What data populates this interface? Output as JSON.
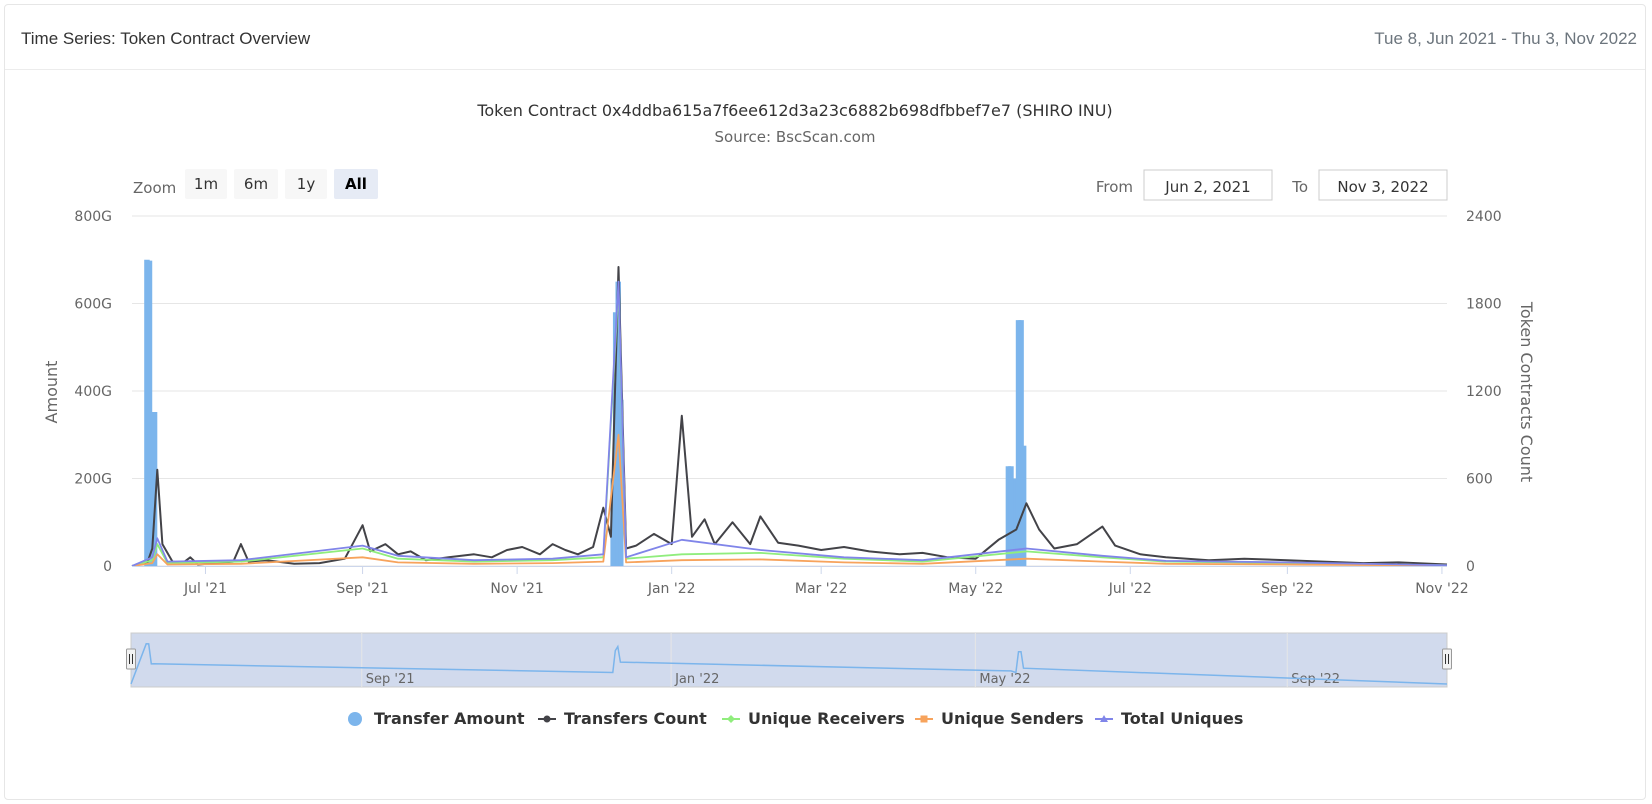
{
  "header": {
    "title": "Time Series: Token Contract Overview",
    "date_range": "Tue 8, Jun 2021 - Thu 3, Nov 2022"
  },
  "zoom": {
    "label": "Zoom",
    "buttons": [
      "1m",
      "6m",
      "1y",
      "All"
    ],
    "active": "All"
  },
  "range_selector": {
    "from_label": "From",
    "from_value": "Jun 2, 2021",
    "to_label": "To",
    "to_value": "Nov 3, 2022"
  },
  "chart_data": {
    "type": "line",
    "title": "Token Contract 0x4ddba615a7f6ee612d3a23c6882b698dfbbef7e7 (SHIRO INU)",
    "subtitle": "Source: BscScan.com",
    "x_range": [
      "2021-06-02",
      "2022-11-03"
    ],
    "x_tick_labels": [
      "Jul '21",
      "Sep '21",
      "Nov '21",
      "Jan '22",
      "Mar '22",
      "May '22",
      "Jul '22",
      "Sep '22",
      "Nov '22"
    ],
    "x_tick_dates": [
      "2021-07-01",
      "2021-09-01",
      "2021-11-01",
      "2022-01-01",
      "2022-03-01",
      "2022-05-01",
      "2022-07-01",
      "2022-09-01",
      "2022-11-01"
    ],
    "y_left": {
      "label": "Amount",
      "range": [
        0,
        800
      ],
      "unit": "G",
      "ticks": [
        "0",
        "200G",
        "400G",
        "600G",
        "800G"
      ]
    },
    "y_right": {
      "label": "Token Contracts Count",
      "range": [
        0,
        2400
      ],
      "ticks": [
        "0",
        "600",
        "1200",
        "1800",
        "2400"
      ]
    },
    "grid": true,
    "legend_position": "bottom",
    "series": [
      {
        "name": "Transfer Amount",
        "type": "column",
        "axis": "left",
        "color": "#7cb5ec",
        "points": [
          [
            "2021-06-08",
            700
          ],
          [
            "2021-06-09",
            698
          ],
          [
            "2021-06-10",
            350
          ],
          [
            "2021-06-11",
            352
          ],
          [
            "2021-12-09",
            200
          ],
          [
            "2021-12-10",
            580
          ],
          [
            "2021-12-11",
            650
          ],
          [
            "2021-12-12",
            380
          ],
          [
            "2022-05-14",
            228
          ],
          [
            "2022-05-15",
            228
          ],
          [
            "2022-05-17",
            200
          ],
          [
            "2022-05-18",
            562
          ],
          [
            "2022-05-19",
            562
          ],
          [
            "2022-05-20",
            275
          ]
        ]
      },
      {
        "name": "Transfers Count",
        "type": "line",
        "axis": "right",
        "color": "#434348",
        "points": [
          [
            "2021-06-02",
            0
          ],
          [
            "2021-06-08",
            20
          ],
          [
            "2021-06-10",
            120
          ],
          [
            "2021-06-12",
            660
          ],
          [
            "2021-06-14",
            150
          ],
          [
            "2021-06-18",
            30
          ],
          [
            "2021-06-22",
            20
          ],
          [
            "2021-06-25",
            60
          ],
          [
            "2021-06-28",
            10
          ],
          [
            "2021-07-05",
            20
          ],
          [
            "2021-07-12",
            30
          ],
          [
            "2021-07-15",
            150
          ],
          [
            "2021-07-18",
            30
          ],
          [
            "2021-07-25",
            40
          ],
          [
            "2021-08-05",
            15
          ],
          [
            "2021-08-15",
            20
          ],
          [
            "2021-08-25",
            50
          ],
          [
            "2021-09-01",
            280
          ],
          [
            "2021-09-04",
            100
          ],
          [
            "2021-09-10",
            150
          ],
          [
            "2021-09-15",
            80
          ],
          [
            "2021-09-20",
            100
          ],
          [
            "2021-09-26",
            40
          ],
          [
            "2021-10-05",
            60
          ],
          [
            "2021-10-15",
            80
          ],
          [
            "2021-10-22",
            60
          ],
          [
            "2021-10-28",
            110
          ],
          [
            "2021-11-03",
            130
          ],
          [
            "2021-11-10",
            80
          ],
          [
            "2021-11-15",
            150
          ],
          [
            "2021-11-20",
            110
          ],
          [
            "2021-11-25",
            80
          ],
          [
            "2021-12-01",
            130
          ],
          [
            "2021-12-05",
            400
          ],
          [
            "2021-12-08",
            200
          ],
          [
            "2021-12-11",
            2050
          ],
          [
            "2021-12-14",
            120
          ],
          [
            "2021-12-18",
            140
          ],
          [
            "2021-12-25",
            220
          ],
          [
            "2022-01-01",
            150
          ],
          [
            "2022-01-05",
            1030
          ],
          [
            "2022-01-09",
            200
          ],
          [
            "2022-01-14",
            320
          ],
          [
            "2022-01-18",
            150
          ],
          [
            "2022-01-25",
            300
          ],
          [
            "2022-02-01",
            150
          ],
          [
            "2022-02-05",
            340
          ],
          [
            "2022-02-12",
            160
          ],
          [
            "2022-02-20",
            140
          ],
          [
            "2022-03-01",
            110
          ],
          [
            "2022-03-10",
            130
          ],
          [
            "2022-03-20",
            100
          ],
          [
            "2022-04-01",
            80
          ],
          [
            "2022-04-10",
            90
          ],
          [
            "2022-04-20",
            60
          ],
          [
            "2022-05-01",
            50
          ],
          [
            "2022-05-10",
            180
          ],
          [
            "2022-05-17",
            250
          ],
          [
            "2022-05-21",
            430
          ],
          [
            "2022-05-26",
            250
          ],
          [
            "2022-06-01",
            120
          ],
          [
            "2022-06-10",
            150
          ],
          [
            "2022-06-20",
            270
          ],
          [
            "2022-06-25",
            140
          ],
          [
            "2022-07-05",
            80
          ],
          [
            "2022-07-15",
            60
          ],
          [
            "2022-08-01",
            40
          ],
          [
            "2022-08-15",
            50
          ],
          [
            "2022-09-01",
            40
          ],
          [
            "2022-09-15",
            30
          ],
          [
            "2022-10-01",
            20
          ],
          [
            "2022-10-15",
            25
          ],
          [
            "2022-11-03",
            10
          ]
        ]
      },
      {
        "name": "Unique Receivers",
        "type": "line",
        "axis": "right",
        "color": "#90ed7d",
        "points": [
          [
            "2021-06-02",
            0
          ],
          [
            "2021-06-10",
            40
          ],
          [
            "2021-06-12",
            150
          ],
          [
            "2021-06-16",
            20
          ],
          [
            "2021-07-15",
            30
          ],
          [
            "2021-09-01",
            120
          ],
          [
            "2021-09-15",
            50
          ],
          [
            "2021-10-15",
            30
          ],
          [
            "2021-11-15",
            40
          ],
          [
            "2021-12-05",
            60
          ],
          [
            "2021-12-11",
            1900
          ],
          [
            "2021-12-14",
            50
          ],
          [
            "2022-01-05",
            80
          ],
          [
            "2022-02-05",
            90
          ],
          [
            "2022-03-10",
            50
          ],
          [
            "2022-04-10",
            30
          ],
          [
            "2022-05-21",
            100
          ],
          [
            "2022-06-20",
            60
          ],
          [
            "2022-07-15",
            30
          ],
          [
            "2022-09-01",
            20
          ],
          [
            "2022-11-03",
            5
          ]
        ]
      },
      {
        "name": "Unique Senders",
        "type": "line",
        "axis": "right",
        "color": "#f7a35c",
        "points": [
          [
            "2021-06-02",
            0
          ],
          [
            "2021-06-10",
            20
          ],
          [
            "2021-06-12",
            80
          ],
          [
            "2021-06-16",
            10
          ],
          [
            "2021-07-15",
            15
          ],
          [
            "2021-09-01",
            60
          ],
          [
            "2021-09-15",
            25
          ],
          [
            "2021-10-15",
            15
          ],
          [
            "2021-11-15",
            20
          ],
          [
            "2021-12-05",
            30
          ],
          [
            "2021-12-11",
            900
          ],
          [
            "2021-12-14",
            25
          ],
          [
            "2022-01-05",
            40
          ],
          [
            "2022-02-05",
            45
          ],
          [
            "2022-03-10",
            25
          ],
          [
            "2022-04-10",
            15
          ],
          [
            "2022-05-21",
            50
          ],
          [
            "2022-06-20",
            30
          ],
          [
            "2022-07-15",
            15
          ],
          [
            "2022-09-01",
            10
          ],
          [
            "2022-11-03",
            3
          ]
        ]
      },
      {
        "name": "Total Uniques",
        "type": "line",
        "axis": "right",
        "color": "#8085e9",
        "points": [
          [
            "2021-06-02",
            0
          ],
          [
            "2021-06-10",
            60
          ],
          [
            "2021-06-12",
            190
          ],
          [
            "2021-06-16",
            30
          ],
          [
            "2021-07-15",
            40
          ],
          [
            "2021-09-01",
            140
          ],
          [
            "2021-09-15",
            70
          ],
          [
            "2021-10-15",
            40
          ],
          [
            "2021-11-15",
            50
          ],
          [
            "2021-12-05",
            80
          ],
          [
            "2021-12-11",
            1950
          ],
          [
            "2021-12-14",
            60
          ],
          [
            "2022-01-05",
            180
          ],
          [
            "2022-02-05",
            110
          ],
          [
            "2022-03-10",
            60
          ],
          [
            "2022-04-10",
            40
          ],
          [
            "2022-05-21",
            120
          ],
          [
            "2022-06-20",
            70
          ],
          [
            "2022-07-15",
            35
          ],
          [
            "2022-09-01",
            25
          ],
          [
            "2022-11-03",
            5
          ]
        ]
      }
    ],
    "navigator": {
      "x_tick_labels": [
        "Sep '21",
        "Jan '22",
        "May '22",
        "Sep '22"
      ],
      "x_tick_dates": [
        "2021-09-01",
        "2022-01-01",
        "2022-05-01",
        "2022-09-01"
      ]
    }
  }
}
